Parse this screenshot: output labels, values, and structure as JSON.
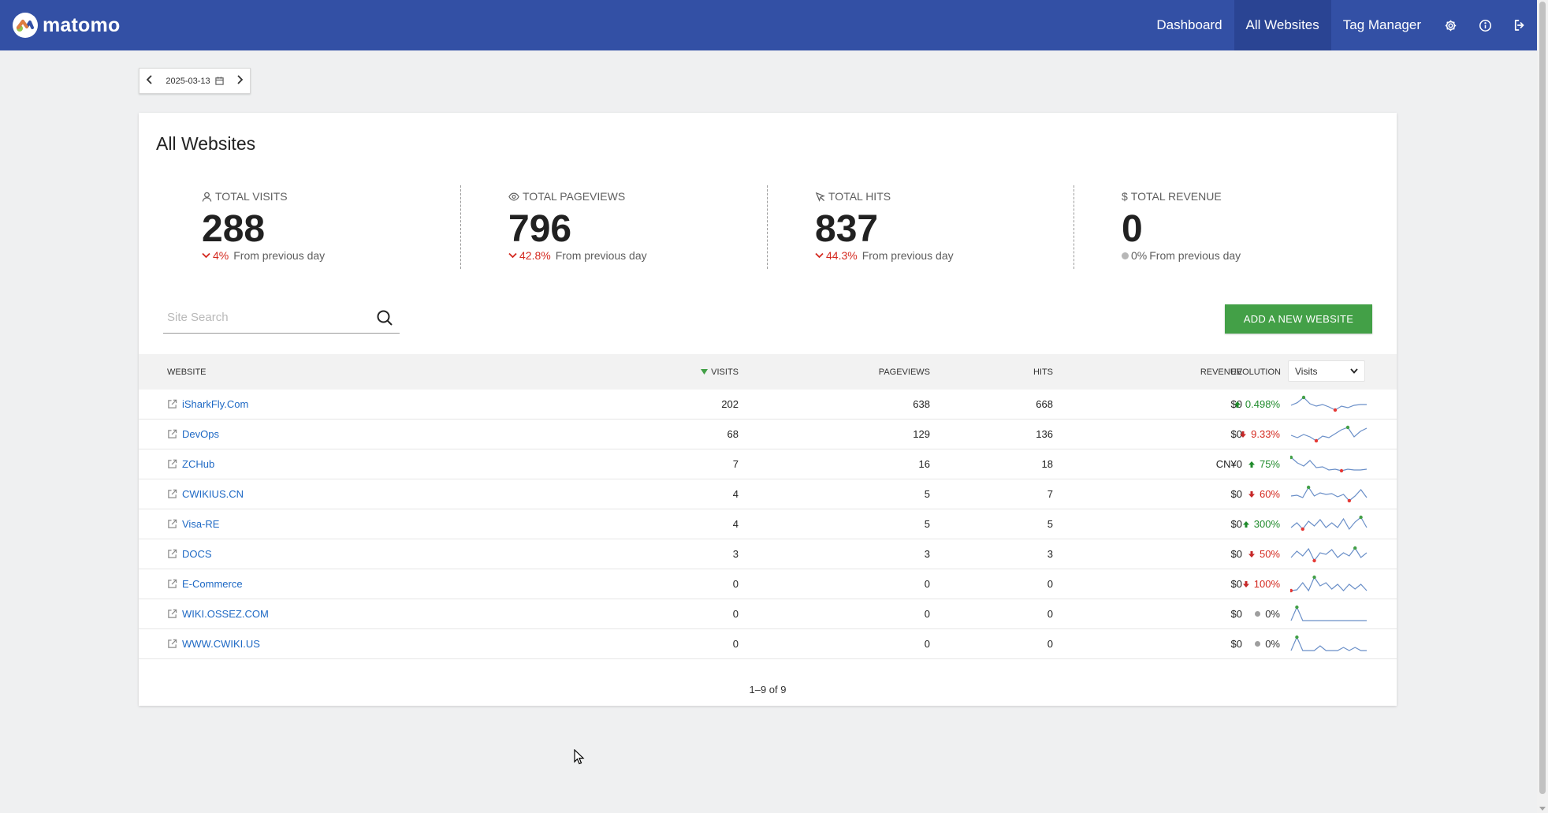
{
  "header": {
    "logo_text": "matomo",
    "nav": [
      {
        "label": "Dashboard"
      },
      {
        "label": "All Websites"
      },
      {
        "label": "Tag Manager"
      }
    ],
    "icons": [
      "gear-icon",
      "info-icon",
      "logout-icon"
    ]
  },
  "date_picker": {
    "value": "2025-03-13"
  },
  "page": {
    "title": "All Websites"
  },
  "kpis": [
    {
      "label": "TOTAL VISITS",
      "icon": "user-icon",
      "value": "288",
      "change": "4%",
      "direction": "down",
      "suffix": "From previous day"
    },
    {
      "label": "TOTAL PAGEVIEWS",
      "icon": "eye-icon",
      "value": "796",
      "change": "42.8%",
      "direction": "down",
      "suffix": "From previous day"
    },
    {
      "label": "TOTAL HITS",
      "icon": "hits-icon",
      "value": "837",
      "change": "44.3%",
      "direction": "down",
      "suffix": "From previous day"
    },
    {
      "label": "TOTAL REVENUE",
      "icon": "dollar-icon",
      "value": "0",
      "change": "0%",
      "direction": "neutral",
      "suffix": "From previous day"
    }
  ],
  "search": {
    "placeholder": "Site Search",
    "value": ""
  },
  "add_button": {
    "label": "ADD A NEW WEBSITE"
  },
  "table": {
    "columns": {
      "website": "WEBSITE",
      "visits": "VISITS",
      "pageviews": "PAGEVIEWS",
      "hits": "HITS",
      "revenue": "REVENUE",
      "evolution": "EVOLUTION"
    },
    "evolution_metric": "Visits",
    "rows": [
      {
        "site": "iSharkFly.Com",
        "visits": "202",
        "pageviews": "638",
        "hits": "668",
        "revenue": "$0",
        "evolution": "0.498%",
        "trend": "up",
        "spark": [
          0.45,
          0.62,
          0.95,
          0.55,
          0.4,
          0.5,
          0.35,
          0.15,
          0.4,
          0.3,
          0.45,
          0.5,
          0.5
        ],
        "max_i": 2,
        "min_i": 7
      },
      {
        "site": "DevOps",
        "visits": "68",
        "pageviews": "129",
        "hits": "136",
        "revenue": "$0",
        "evolution": "9.33%",
        "trend": "down",
        "spark": [
          0.45,
          0.3,
          0.5,
          0.35,
          0.1,
          0.4,
          0.3,
          0.55,
          0.8,
          0.95,
          0.35,
          0.7,
          0.9
        ],
        "max_i": 9,
        "min_i": 4
      },
      {
        "site": "ZCHub",
        "visits": "7",
        "pageviews": "16",
        "hits": "18",
        "revenue": "CN¥0",
        "evolution": "75%",
        "trend": "up",
        "spark": [
          0.95,
          0.6,
          0.4,
          0.75,
          0.3,
          0.35,
          0.15,
          0.2,
          0.1,
          0.2,
          0.15,
          0.15,
          0.2
        ],
        "max_i": 0,
        "min_i": 8
      },
      {
        "site": "CWIKIUS.CN",
        "visits": "4",
        "pageviews": "5",
        "hits": "7",
        "revenue": "$0",
        "evolution": "60%",
        "trend": "down",
        "spark": [
          0.4,
          0.45,
          0.3,
          0.95,
          0.4,
          0.6,
          0.5,
          0.55,
          0.35,
          0.5,
          0.1,
          0.4,
          0.8,
          0.3
        ],
        "max_i": 3,
        "min_i": 10
      },
      {
        "site": "Visa-RE",
        "visits": "4",
        "pageviews": "5",
        "hits": "5",
        "revenue": "$0",
        "evolution": "300%",
        "trend": "up",
        "spark": [
          0.3,
          0.6,
          0.2,
          0.7,
          0.4,
          0.8,
          0.3,
          0.6,
          0.3,
          0.85,
          0.2,
          0.65,
          0.95,
          0.3
        ],
        "max_i": 12,
        "min_i": 2
      },
      {
        "site": "DOCS",
        "visits": "3",
        "pageviews": "3",
        "hits": "3",
        "revenue": "$0",
        "evolution": "50%",
        "trend": "down",
        "spark": [
          0.3,
          0.7,
          0.4,
          0.85,
          0.1,
          0.6,
          0.5,
          0.8,
          0.3,
          0.6,
          0.4,
          0.9,
          0.3,
          0.6
        ],
        "max_i": 11,
        "min_i": 4
      },
      {
        "site": "E-Commerce",
        "visits": "0",
        "pageviews": "0",
        "hits": "0",
        "revenue": "$0",
        "evolution": "100%",
        "trend": "down",
        "spark": [
          0.1,
          0.15,
          0.6,
          0.1,
          0.95,
          0.4,
          0.6,
          0.2,
          0.5,
          0.1,
          0.5,
          0.2,
          0.5,
          0.1
        ],
        "max_i": 4,
        "min_i": 0
      },
      {
        "site": "WIKI.OSSEZ.COM",
        "visits": "0",
        "pageviews": "0",
        "hits": "0",
        "revenue": "$0",
        "evolution": "0%",
        "trend": "neutral",
        "spark": [
          0.1,
          0.95,
          0.1,
          0.1,
          0.1,
          0.1,
          0.1,
          0.1,
          0.1,
          0.1,
          0.1,
          0.1,
          0.1,
          0.1
        ],
        "max_i": 1,
        "min_i": -1
      },
      {
        "site": "WWW.CWIKI.US",
        "visits": "0",
        "pageviews": "0",
        "hits": "0",
        "revenue": "$0",
        "evolution": "0%",
        "trend": "neutral",
        "spark": [
          0.1,
          0.95,
          0.1,
          0.1,
          0.1,
          0.4,
          0.1,
          0.1,
          0.1,
          0.3,
          0.1,
          0.3,
          0.1,
          0.1
        ],
        "max_i": 1,
        "min_i": -1
      }
    ],
    "pagination": "1–9 of 9"
  }
}
